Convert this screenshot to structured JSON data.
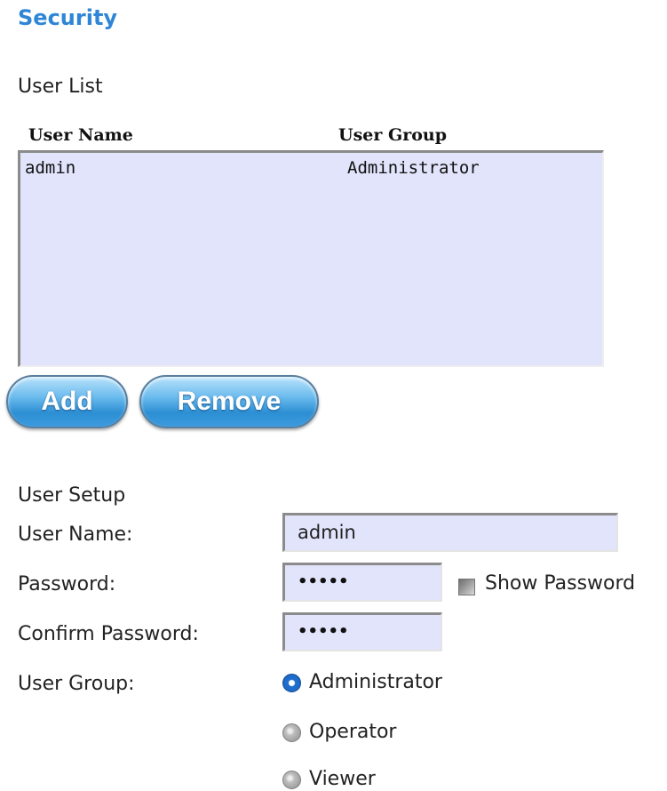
{
  "page": {
    "title": "Security"
  },
  "user_list": {
    "section_label": "User List",
    "columns": [
      "User Name",
      "User Group"
    ],
    "rows": [
      {
        "user_name": "admin",
        "user_group": "Administrator"
      }
    ],
    "add_label": "Add",
    "remove_label": "Remove"
  },
  "user_setup": {
    "section_label": "User Setup",
    "user_name_label": "User Name:",
    "user_name_value": "admin",
    "password_label": "Password:",
    "password_value": "•••••",
    "show_password_label": "Show Password",
    "show_password_checked": false,
    "confirm_password_label": "Confirm Password:",
    "confirm_password_value": "•••••",
    "user_group_label": "User Group:",
    "groups": [
      {
        "label": "Administrator",
        "selected": true
      },
      {
        "label": "Operator",
        "selected": false
      },
      {
        "label": "Viewer",
        "selected": false
      }
    ]
  },
  "colors": {
    "title": "#2f86d6",
    "field_background": "#e1e4fb",
    "button_blue": "#2d8fd3",
    "radio_selected": "#1e64c2"
  },
  "icons": {
    "show_password_checkbox": "checkbox-icon",
    "radio_selected": "radio-checked-icon",
    "radio_unselected": "radio-unchecked-icon"
  }
}
